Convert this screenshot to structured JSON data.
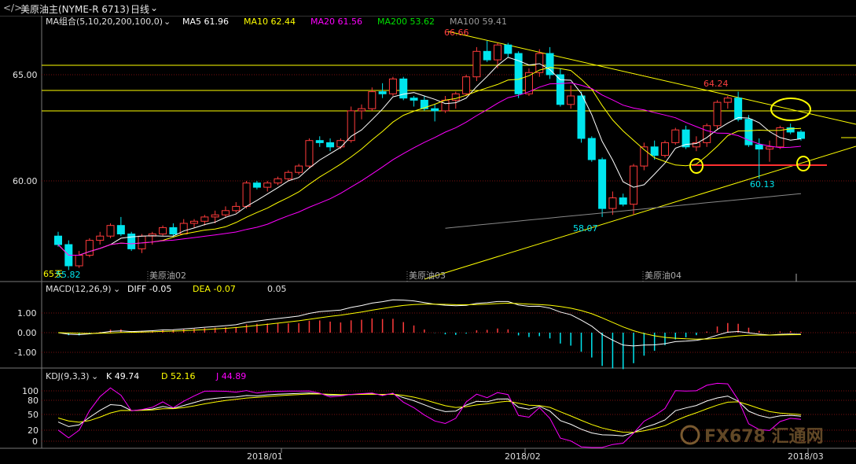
{
  "header": {
    "symbol_glyph": "</>",
    "instrument": "美原油主(NYME-R 6713)",
    "period": "日线",
    "period_arrow": "chevron-down-icon"
  },
  "main_panel": {
    "ma_title": "MA组合(5,10,20,200,100,0)",
    "ma_values": [
      {
        "label": "MA5",
        "value": "61.96",
        "color": "#ffffff"
      },
      {
        "label": "MA10",
        "value": "62.44",
        "color": "#ffff00"
      },
      {
        "label": "MA20",
        "value": "61.56",
        "color": "#ff00ff"
      },
      {
        "label": "MA200",
        "value": "53.62",
        "color": "#00e000"
      },
      {
        "label": "MA100",
        "value": "59.41",
        "color": "#999999"
      }
    ],
    "price_ticks": [
      "65.00",
      "60.00"
    ],
    "contract_labels": [
      "美原油02",
      "美原油03",
      "美原油04"
    ],
    "annotations": {
      "high1": "66.66",
      "high2": "64.24",
      "low1": "58.07",
      "low2": "60.13",
      "left_low": "55.82",
      "left_label": "65天"
    }
  },
  "macd_panel": {
    "title": "MACD(12,26,9)",
    "diff_label": "DIFF",
    "diff_value": "-0.05",
    "dea_label": "DEA",
    "dea_value": "-0.07",
    "macd_value": "0.05",
    "ticks": [
      "1.00",
      "0.00",
      "-1.00"
    ]
  },
  "kdj_panel": {
    "title": "KDJ(9,3,3)",
    "k_label": "K",
    "k_value": "49.74",
    "d_label": "D",
    "d_value": "52.16",
    "j_label": "J",
    "j_value": "44.89",
    "ticks": [
      "100",
      "80",
      "50",
      "20",
      "0"
    ]
  },
  "date_axis": [
    "2018/01",
    "2018/02",
    "2018/03"
  ],
  "watermark": "FX678 汇通网",
  "colors": {
    "up": "#ff3b3b",
    "down": "#00e5ee",
    "ma5": "#ffffff",
    "ma10": "#ffff00",
    "ma20": "#ff00ff",
    "ma100": "#888888",
    "trend": "#ffff00",
    "support": "#ff3030"
  },
  "chart_data": {
    "type": "candlestick",
    "ylim": [
      56,
      68
    ],
    "candles": [
      [
        57.4,
        57.6,
        56.9,
        57.0
      ],
      [
        57.0,
        57.2,
        55.8,
        56.0
      ],
      [
        56.0,
        56.7,
        55.9,
        56.5
      ],
      [
        56.5,
        57.3,
        56.4,
        57.2
      ],
      [
        57.2,
        57.6,
        57.0,
        57.4
      ],
      [
        57.4,
        58.0,
        57.3,
        57.9
      ],
      [
        57.9,
        58.3,
        57.4,
        57.5
      ],
      [
        57.5,
        57.6,
        56.7,
        56.8
      ],
      [
        56.8,
        57.5,
        56.6,
        57.4
      ],
      [
        57.4,
        57.6,
        57.0,
        57.5
      ],
      [
        57.5,
        57.9,
        57.4,
        57.8
      ],
      [
        57.8,
        58.0,
        57.4,
        57.5
      ],
      [
        57.5,
        58.2,
        57.5,
        58.0
      ],
      [
        58.0,
        58.2,
        57.8,
        58.1
      ],
      [
        58.1,
        58.4,
        57.9,
        58.3
      ],
      [
        58.3,
        58.6,
        58.0,
        58.4
      ],
      [
        58.4,
        58.8,
        58.3,
        58.6
      ],
      [
        58.6,
        59.0,
        58.5,
        58.8
      ],
      [
        58.8,
        60.0,
        58.7,
        59.9
      ],
      [
        59.9,
        60.0,
        59.6,
        59.7
      ],
      [
        59.7,
        60.0,
        59.5,
        59.9
      ],
      [
        59.9,
        60.2,
        59.8,
        60.1
      ],
      [
        60.1,
        60.5,
        60.0,
        60.4
      ],
      [
        60.4,
        60.8,
        60.3,
        60.7
      ],
      [
        60.7,
        62.0,
        60.6,
        61.9
      ],
      [
        61.9,
        62.1,
        61.6,
        61.8
      ],
      [
        61.8,
        62.0,
        61.4,
        61.6
      ],
      [
        61.6,
        62.0,
        61.5,
        61.9
      ],
      [
        61.9,
        63.5,
        61.8,
        63.3
      ],
      [
        63.3,
        63.6,
        62.9,
        63.4
      ],
      [
        63.4,
        64.4,
        63.3,
        64.2
      ],
      [
        64.2,
        64.6,
        63.9,
        64.1
      ],
      [
        64.1,
        64.9,
        64.0,
        64.8
      ],
      [
        64.8,
        64.9,
        63.8,
        63.9
      ],
      [
        63.9,
        64.0,
        63.5,
        63.8
      ],
      [
        63.8,
        64.0,
        63.3,
        63.4
      ],
      [
        63.4,
        63.6,
        62.8,
        63.3
      ],
      [
        63.3,
        64.0,
        63.2,
        63.8
      ],
      [
        63.8,
        64.2,
        63.4,
        64.1
      ],
      [
        64.1,
        65.0,
        64.0,
        64.9
      ],
      [
        64.9,
        66.3,
        64.7,
        66.1
      ],
      [
        66.1,
        66.6,
        65.6,
        65.7
      ],
      [
        65.7,
        66.5,
        65.3,
        66.4
      ],
      [
        66.4,
        66.5,
        65.8,
        66.0
      ],
      [
        66.0,
        66.1,
        63.9,
        64.1
      ],
      [
        64.1,
        65.3,
        64.0,
        65.1
      ],
      [
        65.1,
        66.2,
        64.9,
        66.0
      ],
      [
        66.0,
        66.3,
        64.8,
        65.0
      ],
      [
        65.0,
        65.3,
        63.5,
        63.6
      ],
      [
        63.6,
        64.5,
        63.4,
        64.0
      ],
      [
        64.0,
        64.2,
        61.8,
        62.0
      ],
      [
        62.0,
        62.1,
        60.9,
        61.0
      ],
      [
        61.0,
        61.1,
        58.3,
        58.7
      ],
      [
        58.7,
        59.5,
        58.4,
        59.2
      ],
      [
        59.2,
        59.4,
        58.8,
        58.9
      ],
      [
        58.9,
        60.8,
        58.4,
        60.7
      ],
      [
        60.7,
        61.8,
        60.5,
        61.6
      ],
      [
        61.6,
        61.9,
        61.0,
        61.2
      ],
      [
        61.2,
        61.9,
        61.1,
        61.8
      ],
      [
        61.8,
        62.5,
        61.7,
        62.4
      ],
      [
        62.4,
        62.6,
        61.5,
        61.6
      ],
      [
        61.6,
        62.1,
        61.4,
        61.8
      ],
      [
        61.8,
        62.7,
        61.6,
        62.6
      ],
      [
        62.6,
        63.8,
        62.4,
        63.7
      ],
      [
        63.7,
        64.0,
        63.4,
        63.9
      ],
      [
        63.9,
        64.2,
        62.8,
        62.9
      ],
      [
        62.9,
        63.1,
        61.6,
        61.7
      ],
      [
        61.7,
        62.0,
        60.1,
        61.5
      ],
      [
        61.5,
        61.9,
        60.9,
        61.6
      ],
      [
        61.6,
        62.6,
        61.5,
        62.5
      ],
      [
        62.5,
        62.7,
        62.2,
        62.3
      ],
      [
        62.3,
        62.4,
        61.9,
        62.0
      ]
    ]
  }
}
